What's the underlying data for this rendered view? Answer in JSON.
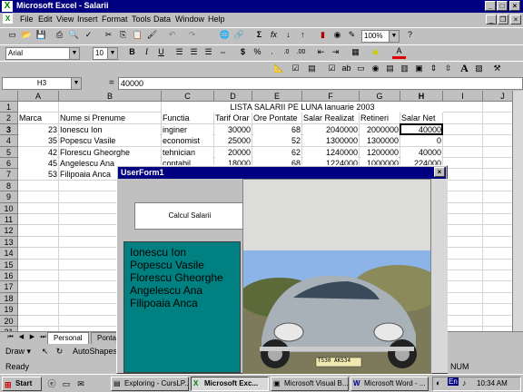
{
  "window": {
    "title": "Microsoft Excel - Salarii"
  },
  "menu": [
    "File",
    "Edit",
    "View",
    "Insert",
    "Format",
    "Tools",
    "Data",
    "Window",
    "Help"
  ],
  "toolbar": {
    "zoom": "100%",
    "font": "Arial",
    "font_size": "10"
  },
  "formula_bar": {
    "name_box": "H3",
    "equals": "=",
    "value": "40000"
  },
  "sheet": {
    "columns": [
      "A",
      "B",
      "C",
      "D",
      "E",
      "F",
      "G",
      "H",
      "I",
      "J"
    ],
    "rows": [
      "1",
      "2",
      "3",
      "4",
      "5",
      "6",
      "7",
      "8",
      "9",
      "10",
      "11",
      "12",
      "13",
      "14",
      "15",
      "16",
      "17",
      "18",
      "19",
      "20",
      "21"
    ],
    "title": "LISTA SALARII PE LUNA Ianuarie 2003",
    "headers": [
      "Marca",
      "Nume si Prenume",
      "Functia",
      "Tarif Orar",
      "Ore Pontate",
      "Salar Realizat",
      "Retineri",
      "Salar Net"
    ],
    "data": [
      [
        "23",
        "Ionescu Ion",
        "inginer",
        "30000",
        "68",
        "2040000",
        "2000000",
        "40000"
      ],
      [
        "35",
        "Popescu Vasile",
        "economist",
        "25000",
        "52",
        "1300000",
        "1300000",
        "0"
      ],
      [
        "42",
        "Florescu Gheorghe",
        "tehnician",
        "20000",
        "62",
        "1240000",
        "1200000",
        "40000"
      ],
      [
        "45",
        "Angelescu Ana",
        "contabil",
        "18000",
        "68",
        "1224000",
        "1000000",
        "224000"
      ],
      [
        "53",
        "Filipoaia Anca",
        "",
        "",
        "",
        "",
        "",
        ""
      ]
    ]
  },
  "sheet_tabs": [
    "Personal",
    "Pontaj"
  ],
  "drawing_toolbar": {
    "draw": "Draw",
    "autoshapes": "AutoShapes"
  },
  "status": {
    "left": "Ready",
    "num": "NUM"
  },
  "userform": {
    "title": "UserForm1",
    "button": "Calcul Salarii",
    "names": [
      "Ionescu Ion",
      "Popescu Vasile",
      "Florescu Gheorghe",
      "Angelescu Ana",
      "Filipoaia Anca"
    ],
    "photo_plate": "T530 AKS34"
  },
  "taskbar": {
    "start": "Start",
    "items": [
      "Exploring - CursLP...",
      "Microsoft Exc...",
      "Microsoft Visual B...",
      "Microsoft Word - ..."
    ],
    "lang": "En",
    "clock": "10:34 AM"
  }
}
